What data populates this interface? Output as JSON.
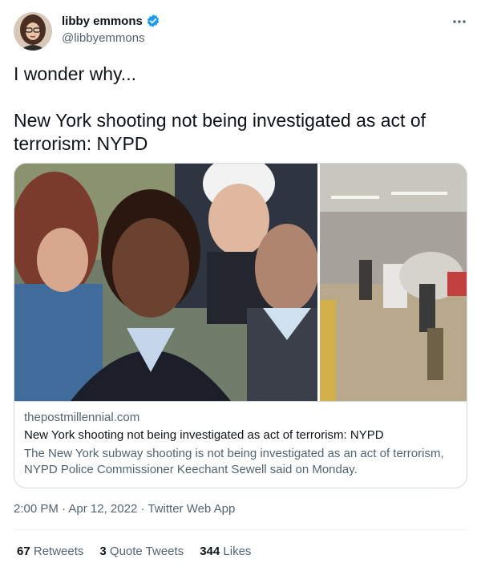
{
  "author": {
    "display_name": "libby emmons",
    "handle": "@libbyemmons",
    "verified": true
  },
  "tweet": {
    "text": "I wonder why...\n\nNew York shooting not being investigated as act of terrorism: NYPD"
  },
  "card": {
    "domain": "thepostmillennial.com",
    "title": "New York shooting not being investigated as act of terrorism: NYPD",
    "description": "The New York subway shooting is not being investigated as an act of terrorism, NYPD Police Commissioner Keechant Sewell said on Monday."
  },
  "meta": {
    "time": "2:00 PM",
    "separator": " · ",
    "date": "Apr 12, 2022",
    "source": "Twitter Web App"
  },
  "stats": {
    "retweets": "67",
    "retweets_label": "Retweets",
    "quotes": "3",
    "quotes_label": "Quote Tweets",
    "likes": "344",
    "likes_label": "Likes"
  },
  "colors": {
    "text": "#0f1419",
    "secondary": "#536471",
    "border": "#cfd9de",
    "verified": "#1d9bf0"
  },
  "icons": {
    "more": "more-dots-icon",
    "verified": "verified-badge-icon"
  }
}
